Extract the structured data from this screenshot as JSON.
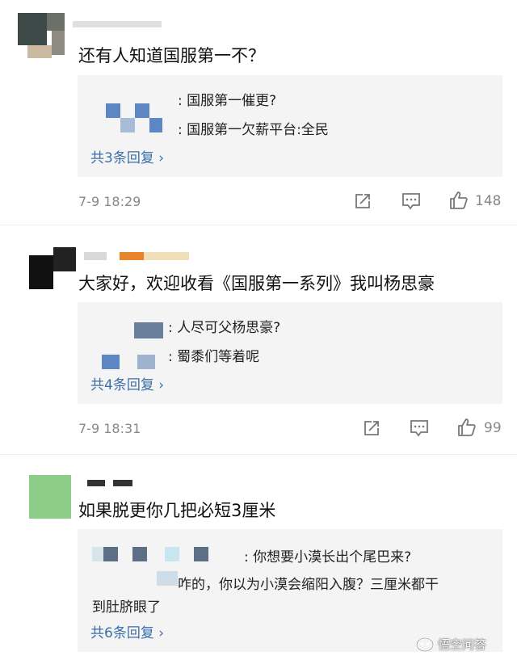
{
  "comments": [
    {
      "text": "还有人知道国服第一不？",
      "replies": [
        ": 国服第一催更?",
        ": 国服第一欠薪平台:全民"
      ],
      "reply_count_label": "共3条回复 ›",
      "time": "7-9 18:29",
      "likes": "148"
    },
    {
      "text": "大家好，欢迎收看《国服第一系列》我叫杨思豪",
      "replies": [
        ": 人尽可父杨思豪?",
        ": 蜀黍们等着呢"
      ],
      "reply_count_label": "共4条回复 ›",
      "time": "7-9 18:31",
      "likes": "99"
    },
    {
      "text": "如果脱更你几把必短3厘米",
      "replies": [
        ": 你想要小漠长出个尾巴来?",
        "咋的，你以为小漠会缩阳入腹？三厘米都干",
        "到肚脐眼了"
      ],
      "reply_count_label": "共6条回复 ›",
      "time": "",
      "likes": ""
    }
  ],
  "watermark": "悟空问答",
  "icons": [
    "share-icon",
    "comment-icon",
    "like-icon",
    "wukong-logo-icon"
  ],
  "colors": {
    "link": "#3b6fa8",
    "meta": "#888888",
    "reply_bg": "#f4f4f4"
  }
}
